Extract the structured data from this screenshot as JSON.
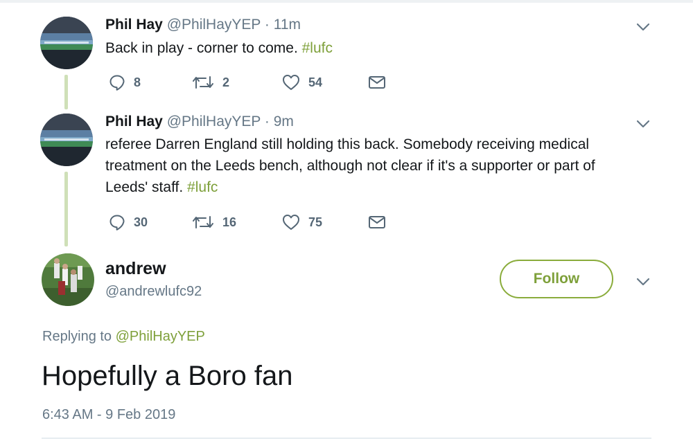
{
  "tweets": [
    {
      "name": "Phil Hay",
      "handle": "@PhilHayYEP",
      "separator": "·",
      "time": "11m",
      "text": "Back in play - corner to come. ",
      "hashtag": "#lufc",
      "replies": "8",
      "retweets": "2",
      "likes": "54"
    },
    {
      "name": "Phil Hay",
      "handle": "@PhilHayYEP",
      "separator": "·",
      "time": "9m",
      "text": "referee Darren England still holding this back. Somebody receiving medical treatment on the Leeds bench, although not clear if it's a supporter or part of Leeds' staff. ",
      "hashtag": "#lufc",
      "replies": "30",
      "retweets": "16",
      "likes": "75"
    }
  ],
  "main_tweet": {
    "name": "andrew",
    "handle": "@andrewlufc92",
    "follow_label": "Follow",
    "replying_prefix": "Replying to ",
    "replying_to": "@PhilHayYEP",
    "text": "Hopefully a Boro fan",
    "timestamp": "6:43 AM - 9 Feb 2019"
  },
  "colors": {
    "accent": "#7ea03a",
    "secondary_text": "#657786",
    "thread_line": "#cfe0b8"
  },
  "icons": [
    "reply-icon",
    "retweet-icon",
    "like-icon",
    "direct-message-icon",
    "chevron-down-icon"
  ]
}
